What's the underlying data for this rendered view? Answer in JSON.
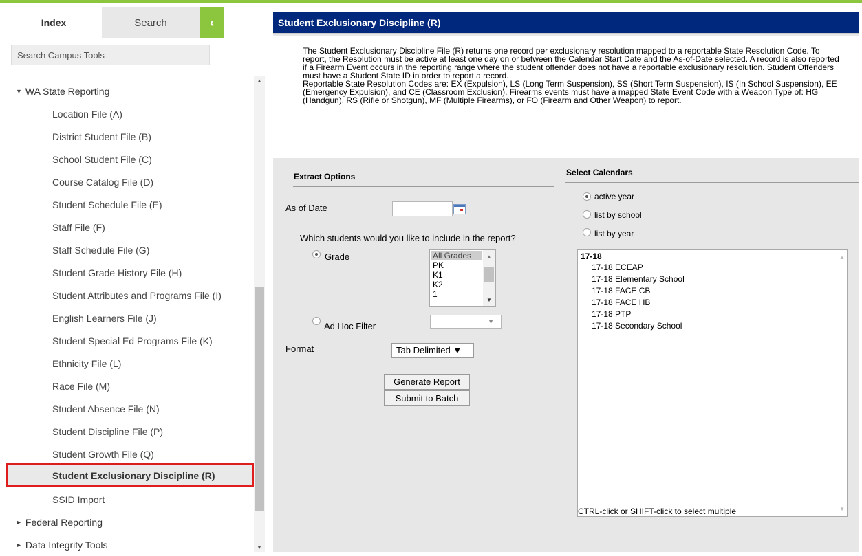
{
  "sidebar": {
    "tab_index": "Index",
    "tab_search": "Search",
    "collapse_glyph": "‹",
    "search_placeholder": "Search Campus Tools",
    "tree": {
      "group_wa": "WA State Reporting",
      "items": [
        "Location File (A)",
        "District Student File (B)",
        "School Student File (C)",
        "Course Catalog File (D)",
        "Student Schedule File (E)",
        "Staff File (F)",
        "Staff Schedule File (G)",
        "Student Grade History File (H)",
        "Student Attributes and Programs File (I)",
        "English Learners File (J)",
        "Student Special Ed Programs File (K)",
        "Ethnicity File (L)",
        "Race File (M)",
        "Student Absence File (N)",
        "Student Discipline File (P)",
        "Student Growth File (Q)",
        "Student Exclusionary Discipline (R)",
        "SSID Import"
      ],
      "selected_item": "Student Exclusionary Discipline (R)",
      "group_federal": "Federal Reporting",
      "group_data_integrity": "Data Integrity Tools"
    }
  },
  "main": {
    "header_title": "Student Exclusionary Discipline (R)",
    "description_p1": "The Student Exclusionary Discipline File (R) returns one record per exclusionary resolution mapped to a reportable State Resolution Code. To report, the Resolution must be active at least one day on or between the Calendar Start Date and the As-of-Date selected. A record is also reported if a Firearm Event occurs in the reporting range where the student offender does not have a reportable exclusionary resolution. Student Offenders must have a Student State ID in order to report a record.",
    "description_p2": "Reportable State Resolution Codes are: EX (Expulsion), LS (Long Term Suspension), SS (Short Term Suspension), IS (In School Suspension), EE (Emergency Expulsion), and CE (Classroom Exclusion). Firearms events must have a mapped State Event Code with a Weapon Type of: HG (Handgun), RS (Rifle or Shotgun), MF (Multiple Firearms), or FO (Firearm and Other Weapon) to report."
  },
  "extract": {
    "title": "Extract Options",
    "as_of_date_label": "As of Date",
    "as_of_date_value": "",
    "students_question": "Which students would you like to include in the report?",
    "grade_label": "Grade",
    "grade_options": [
      "All Grades",
      "PK",
      "K1",
      "K2",
      "1"
    ],
    "grade_selected": "All Grades",
    "adhoc_label": "Ad Hoc Filter",
    "adhoc_value": "",
    "format_label": "Format",
    "format_value": "Tab Delimited ▼",
    "generate_button": "Generate Report",
    "batch_button": "Submit to Batch"
  },
  "calendars": {
    "title": "Select Calendars",
    "radio_active": "active year",
    "radio_school": "list by school",
    "radio_year": "list by year",
    "group": "17-18",
    "options": [
      "17-18 ECEAP",
      "17-18 Elementary School",
      "17-18 FACE CB",
      "17-18 FACE HB",
      "17-18 PTP",
      "17-18 Secondary School"
    ],
    "hint": "CTRL-click or SHIFT-click to select multiple"
  },
  "colors": {
    "accent_green": "#8cc63e",
    "header_navy": "#00287c",
    "selection_outline": "#e01d1d"
  }
}
